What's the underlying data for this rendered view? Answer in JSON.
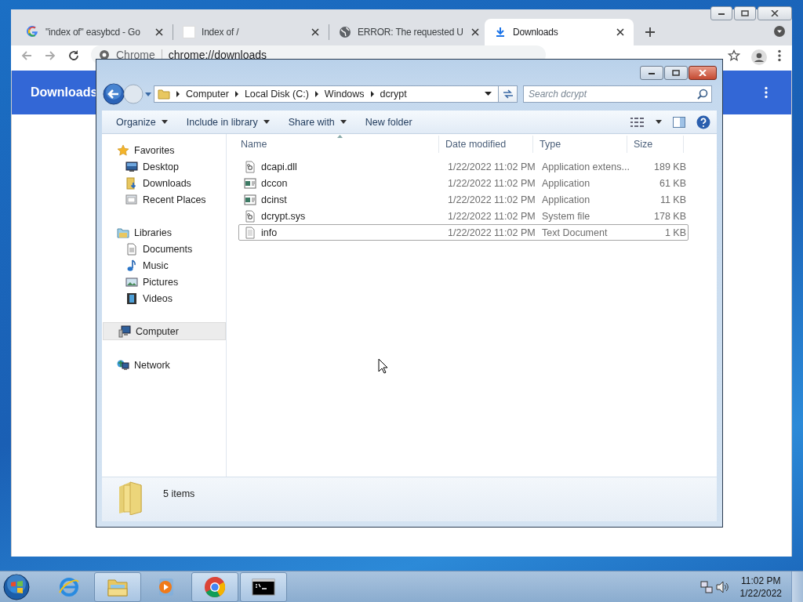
{
  "browser": {
    "tabs": [
      {
        "title": "\"index of\" easybcd - Go",
        "kind": "google",
        "selected": false
      },
      {
        "title": "Index of /",
        "kind": "blank",
        "selected": false
      },
      {
        "title": "ERROR: The requested U",
        "kind": "globe",
        "selected": false
      },
      {
        "title": "Downloads",
        "kind": "download",
        "selected": true
      }
    ],
    "address": {
      "chip": "Chrome",
      "url": "chrome://downloads"
    },
    "page": {
      "heading": "Downloads"
    }
  },
  "explorer": {
    "breadcrumb": [
      "Computer",
      "Local Disk (C:)",
      "Windows",
      "dcrypt"
    ],
    "search": {
      "placeholder": "Search dcrypt"
    },
    "toolbar": [
      {
        "label": "Organize",
        "dropdown": true
      },
      {
        "label": "Include in library",
        "dropdown": true
      },
      {
        "label": "Share with",
        "dropdown": true
      },
      {
        "label": "New folder",
        "dropdown": false
      }
    ],
    "nav": [
      {
        "label": "Favorites",
        "kind": "star",
        "selected": false,
        "children": [
          {
            "label": "Desktop",
            "kind": "desktop",
            "selected": false
          },
          {
            "label": "Downloads",
            "kind": "downloads",
            "selected": false
          },
          {
            "label": "Recent Places",
            "kind": "recent",
            "selected": false
          }
        ]
      },
      {
        "label": "Libraries",
        "kind": "libraries",
        "selected": false,
        "children": [
          {
            "label": "Documents",
            "kind": "documents",
            "selected": false
          },
          {
            "label": "Music",
            "kind": "music",
            "selected": false
          },
          {
            "label": "Pictures",
            "kind": "pictures",
            "selected": false
          },
          {
            "label": "Videos",
            "kind": "videos",
            "selected": false
          }
        ]
      },
      {
        "label": "Computer",
        "kind": "computer",
        "selected": true
      },
      {
        "label": "Network",
        "kind": "network",
        "selected": false
      }
    ],
    "columns": [
      "Name",
      "Date modified",
      "Type",
      "Size"
    ],
    "files": [
      {
        "kind": "dll",
        "name": "dcapi.dll",
        "date": "1/22/2022 11:02 PM",
        "type": "Application extens...",
        "size": "189 KB",
        "selected": false
      },
      {
        "kind": "app",
        "name": "dccon",
        "date": "1/22/2022 11:02 PM",
        "type": "Application",
        "size": "61 KB",
        "selected": false
      },
      {
        "kind": "app",
        "name": "dcinst",
        "date": "1/22/2022 11:02 PM",
        "type": "Application",
        "size": "11 KB",
        "selected": false
      },
      {
        "kind": "dll",
        "name": "dcrypt.sys",
        "date": "1/22/2022 11:02 PM",
        "type": "System file",
        "size": "178 KB",
        "selected": false
      },
      {
        "kind": "text",
        "name": "info",
        "date": "1/22/2022 11:02 PM",
        "type": "Text Document",
        "size": "1 KB",
        "selected": true
      }
    ],
    "status": "5 items"
  },
  "taskbar": {
    "apps": [
      {
        "kind": "ie",
        "active": false
      },
      {
        "kind": "explorer",
        "active": true
      },
      {
        "kind": "media",
        "active": false
      },
      {
        "kind": "chrome",
        "active": true
      },
      {
        "kind": "cmd",
        "active": true
      }
    ],
    "time": "11:02 PM",
    "date": "1/22/2022"
  }
}
